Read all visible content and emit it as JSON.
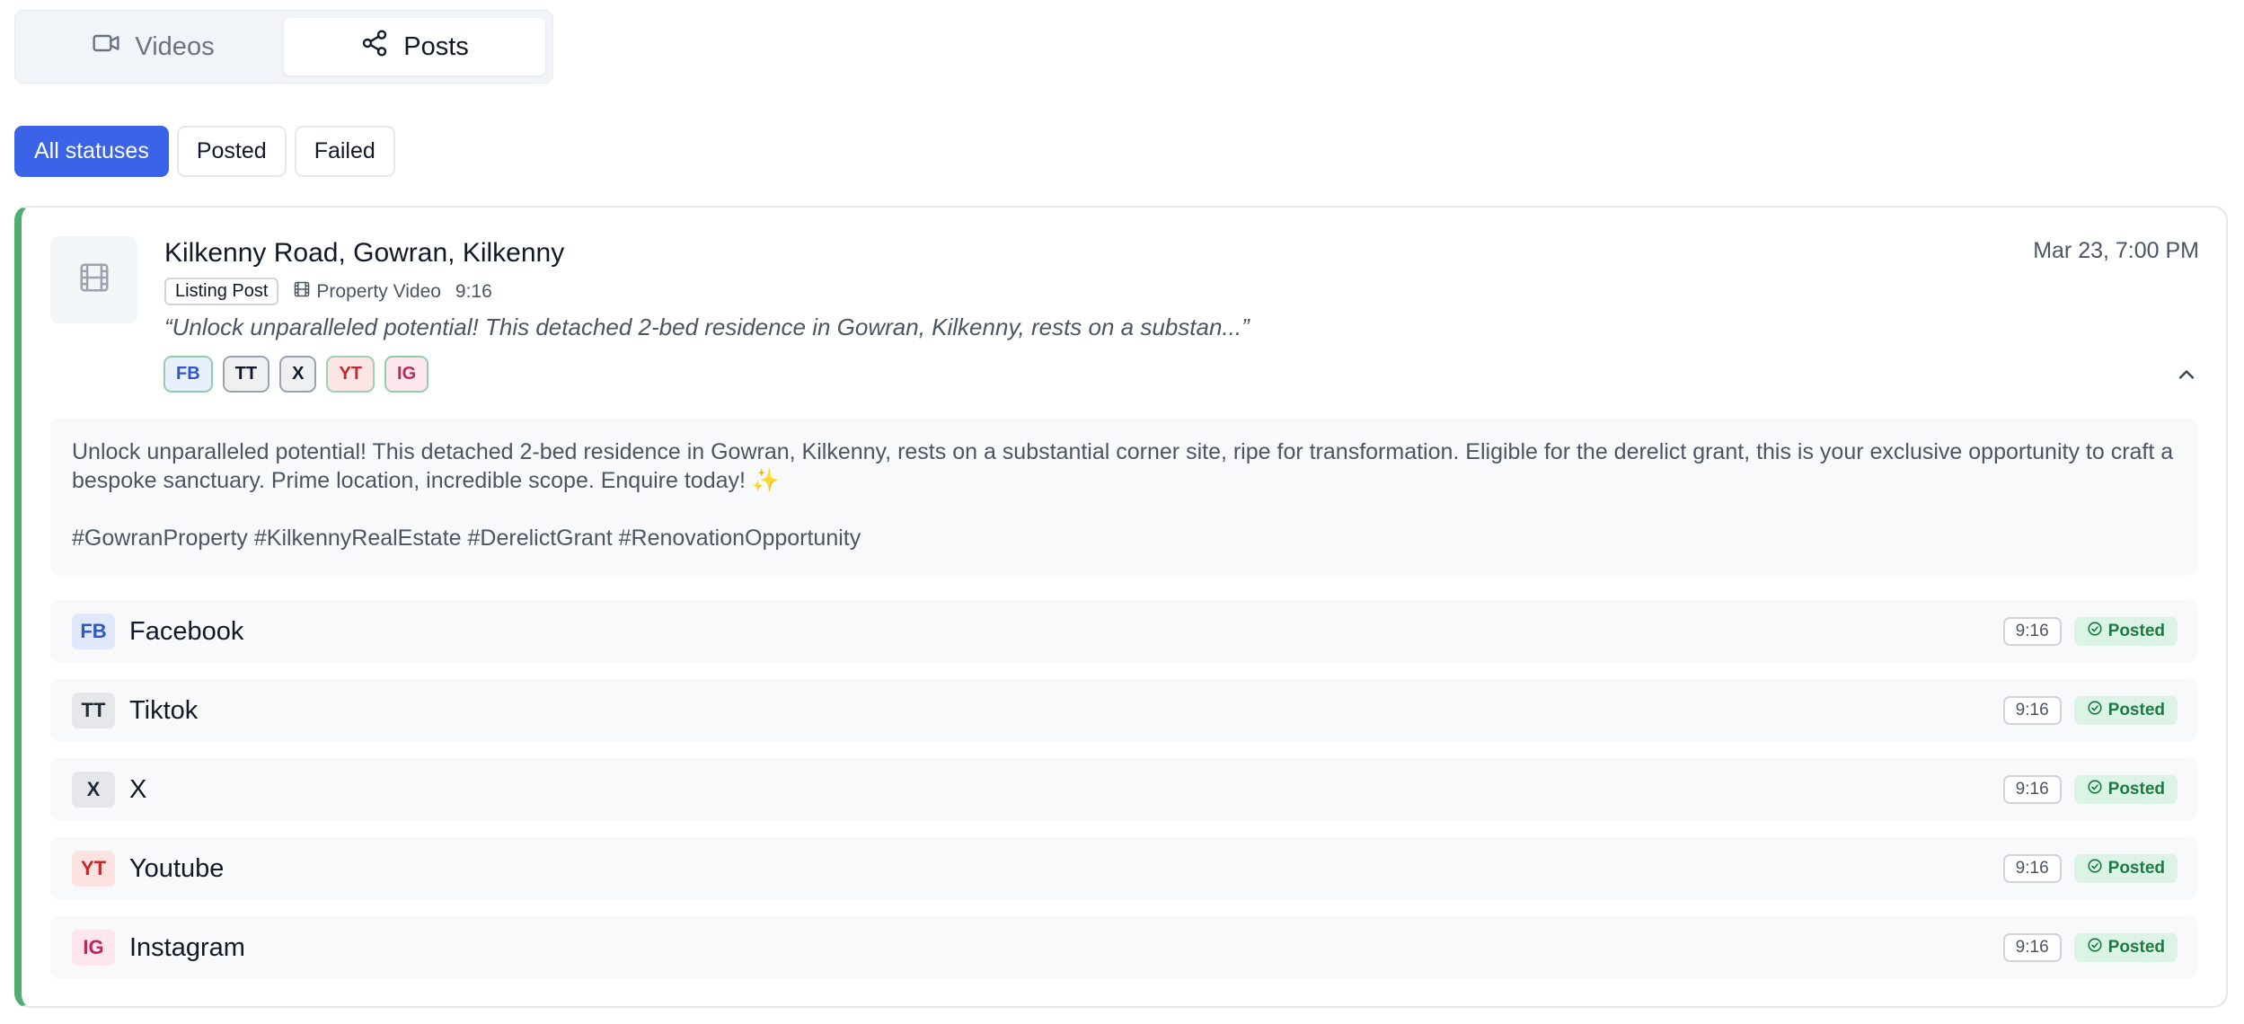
{
  "tabs": [
    {
      "label": "Videos",
      "icon": "video-camera-icon",
      "active": false
    },
    {
      "label": "Posts",
      "icon": "share-icon",
      "active": true
    }
  ],
  "filters": [
    {
      "label": "All statuses",
      "active": true
    },
    {
      "label": "Posted",
      "active": false
    },
    {
      "label": "Failed",
      "active": false
    }
  ],
  "post": {
    "title": "Kilkenny Road, Gowran, Kilkenny",
    "date": "Mar 23, 7:00 PM",
    "type_badge": "Listing Post",
    "video_label": "Property Video",
    "video_ratio": "9:16",
    "quote": "“Unlock unparalleled potential! This detached 2-bed residence in Gowran, Kilkenny, rests on a substan...”",
    "platform_tags": [
      "FB",
      "TT",
      "X",
      "YT",
      "IG"
    ],
    "body": "Unlock unparalleled potential! This detached 2-bed residence in Gowran, Kilkenny, rests on a substantial corner site, ripe for transformation. Eligible for the derelict grant, this is your exclusive opportunity to craft a bespoke sanctuary. Prime location, incredible scope. Enquire today! ✨",
    "hashtags": "#GowranProperty #KilkennyRealEstate #DerelictGrant #RenovationOpportunity",
    "accent_color": "#4ead6f"
  },
  "platforms": [
    {
      "abbr": "FB",
      "name": "Facebook",
      "ratio": "9:16",
      "status": "Posted"
    },
    {
      "abbr": "TT",
      "name": "Tiktok",
      "ratio": "9:16",
      "status": "Posted"
    },
    {
      "abbr": "X",
      "name": "X",
      "ratio": "9:16",
      "status": "Posted"
    },
    {
      "abbr": "YT",
      "name": "Youtube",
      "ratio": "9:16",
      "status": "Posted"
    },
    {
      "abbr": "IG",
      "name": "Instagram",
      "ratio": "9:16",
      "status": "Posted"
    }
  ]
}
